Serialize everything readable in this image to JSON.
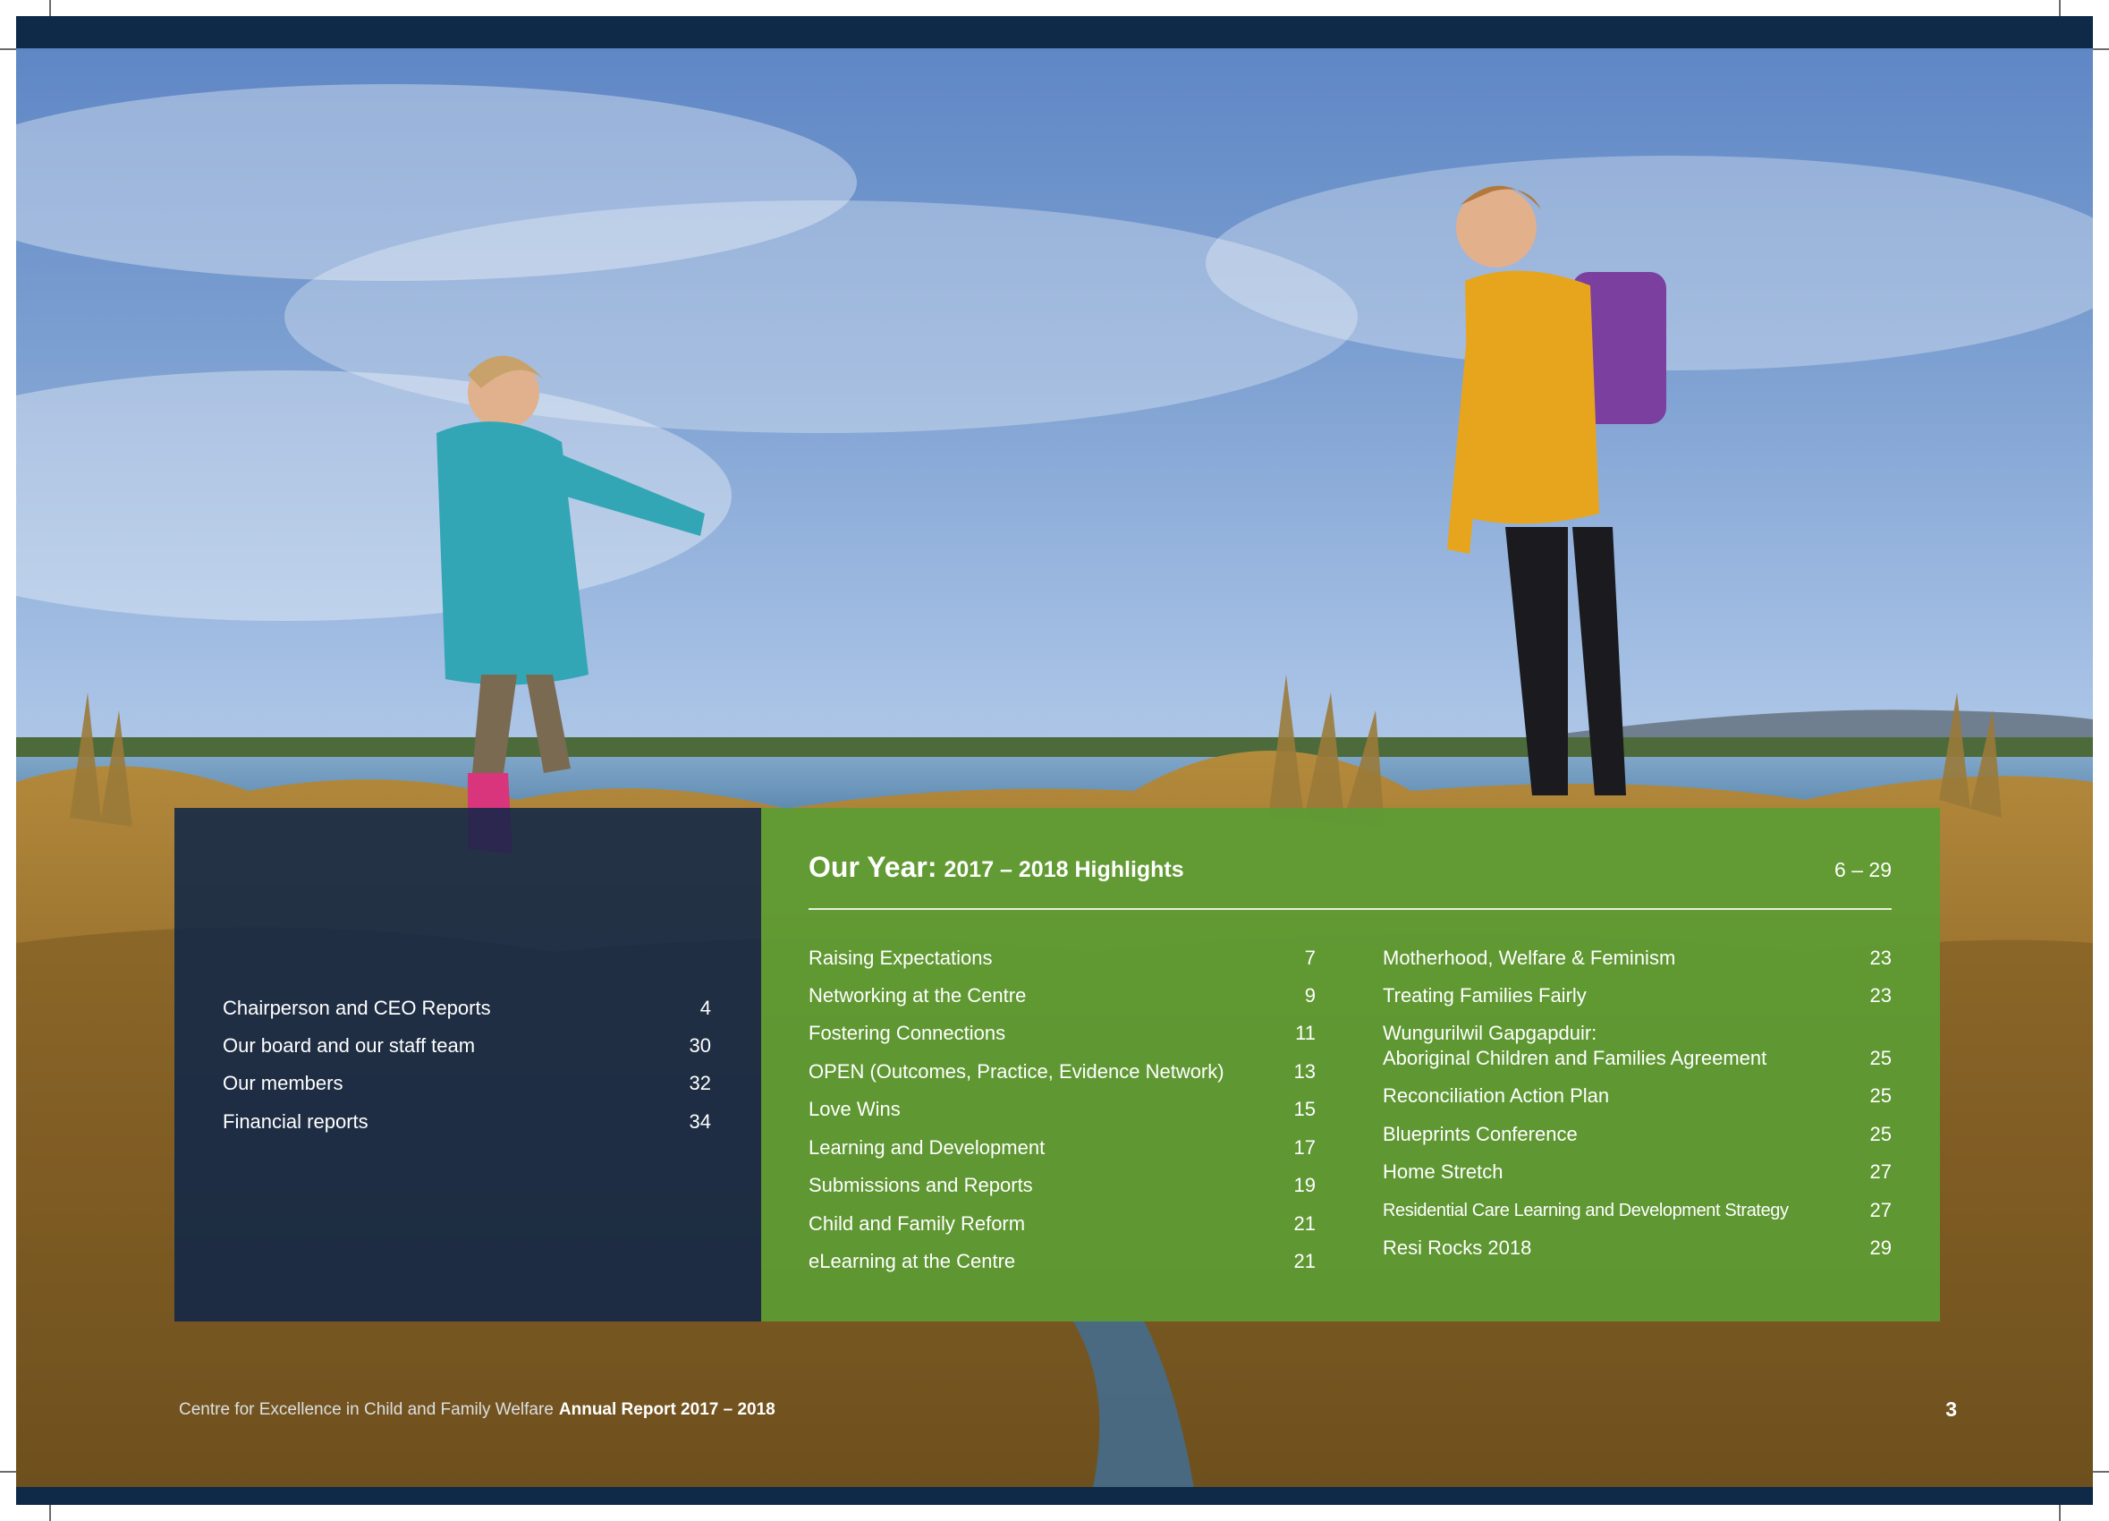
{
  "left_contents": [
    {
      "label": "Chairperson and CEO Reports",
      "page": "4"
    },
    {
      "label": "Our board and our staff team",
      "page": "30"
    },
    {
      "label": "Our members",
      "page": "32"
    },
    {
      "label": "Financial reports",
      "page": "34"
    }
  ],
  "highlights": {
    "title_main": "Our Year:",
    "title_sub": "2017 – 2018 Highlights",
    "range": "6 – 29",
    "col1": [
      {
        "label": "Raising Expectations",
        "page": "7"
      },
      {
        "label": "Networking at the Centre",
        "page": "9"
      },
      {
        "label": "Fostering Connections",
        "page": "11"
      },
      {
        "label": "OPEN (Outcomes, Practice, Evidence Network)",
        "page": "13"
      },
      {
        "label": "Love Wins",
        "page": "15"
      },
      {
        "label": "Learning and Development",
        "page": "17"
      },
      {
        "label": "Submissions and Reports",
        "page": "19"
      },
      {
        "label": "Child and Family Reform",
        "page": "21"
      },
      {
        "label": "eLearning at the Centre",
        "page": "21"
      }
    ],
    "col2": [
      {
        "label": "Motherhood, Welfare & Feminism",
        "page": "23"
      },
      {
        "label": "Treating Families Fairly",
        "page": "23"
      },
      {
        "label": "Wungurilwil Gapgapduir:",
        "label2": "Aboriginal Children and Families Agreement",
        "page": "25"
      },
      {
        "label": "Reconciliation Action Plan",
        "page": "25"
      },
      {
        "label": "Blueprints Conference",
        "page": "25"
      },
      {
        "label": "Home Stretch",
        "page": "27"
      },
      {
        "label": "Residential Care Learning and Development Strategy",
        "page": "27"
      },
      {
        "label": "Resi Rocks 2018",
        "page": "29"
      }
    ]
  },
  "footer": {
    "org": "Centre for Excellence in Child and Family Welfare",
    "report": "Annual Report 2017 – 2018",
    "page_number": "3"
  },
  "colors": {
    "navy": "#0f2a48",
    "green": "#5c9c34"
  }
}
